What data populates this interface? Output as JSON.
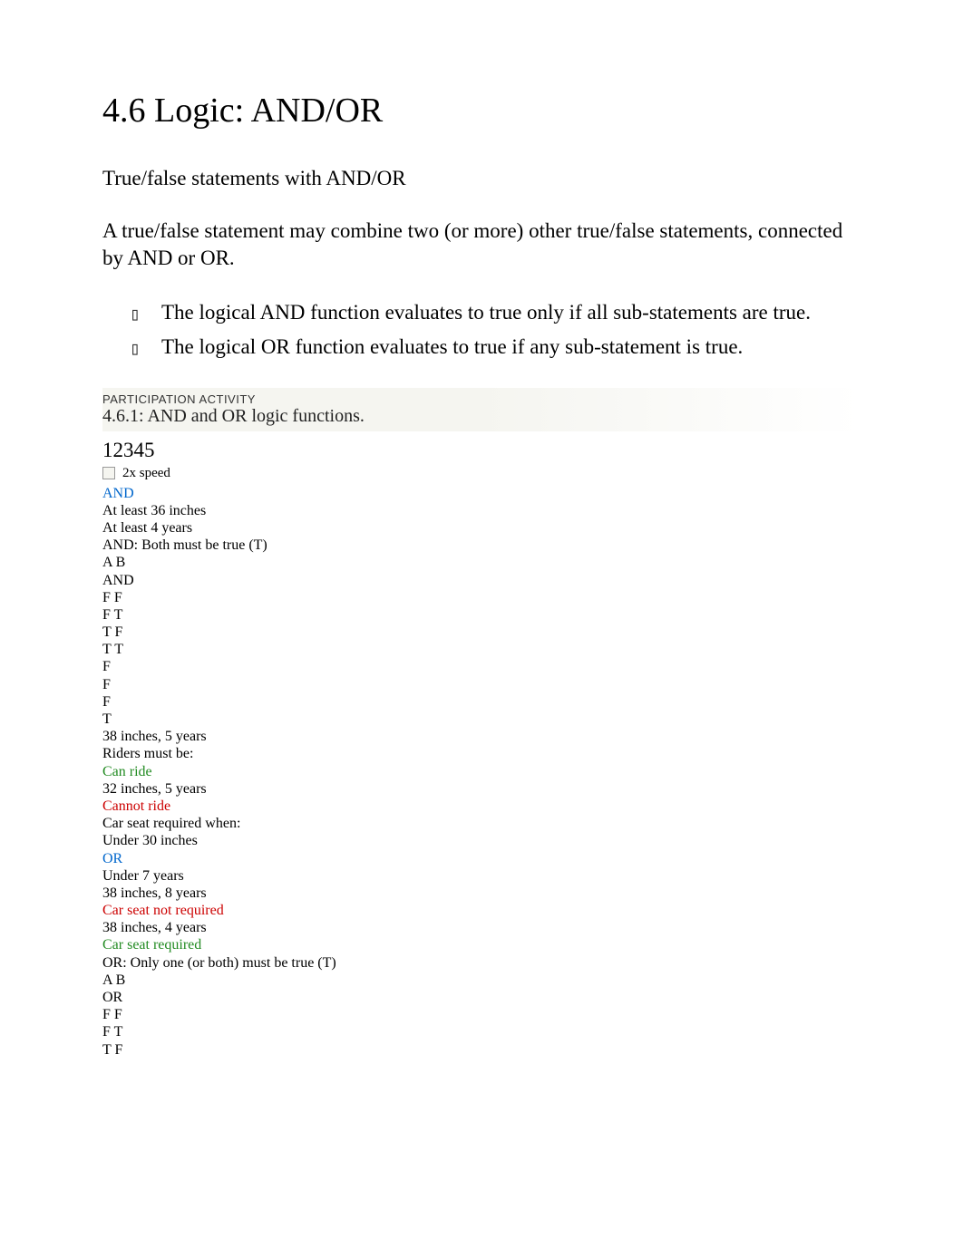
{
  "heading": "4.6 Logic: AND/OR",
  "subheading": "True/false statements with AND/OR",
  "intro": "A true/false statement may combine two (or more) other true/false statements, connected by AND or OR.",
  "bullets": [
    {
      "prefix": "The ",
      "term": "logical AND",
      "mid": "  function evaluates to true only if     all sub-statements are true."
    },
    {
      "prefix": "The ",
      "term": "logical OR",
      "mid": "  function evaluates to true if     any  sub-statement is true."
    }
  ],
  "activity": {
    "label": "PARTICIPATION ACTIVITY",
    "title": "4.6.1: AND and OR logic functions."
  },
  "nav": "12345",
  "speed": "2x speed",
  "lines": [
    {
      "text": "AND",
      "cls": "color-blue"
    },
    {
      "text": "At least 36 inches",
      "cls": ""
    },
    {
      "text": "At least 4 years",
      "cls": ""
    },
    {
      "text": "AND: Both must be true (T)",
      "cls": ""
    },
    {
      "text": "A B",
      "cls": ""
    },
    {
      "text": "AND",
      "cls": ""
    },
    {
      "text": "F F",
      "cls": ""
    },
    {
      "text": "F T",
      "cls": ""
    },
    {
      "text": "T F",
      "cls": ""
    },
    {
      "text": "T T",
      "cls": ""
    },
    {
      "text": "F",
      "cls": ""
    },
    {
      "text": "F",
      "cls": ""
    },
    {
      "text": "F",
      "cls": ""
    },
    {
      "text": "T",
      "cls": ""
    },
    {
      "text": "38 inches, 5 years",
      "cls": ""
    },
    {
      "text": "Riders must be:",
      "cls": ""
    },
    {
      "text": "Can ride",
      "cls": "color-green"
    },
    {
      "text": "32 inches, 5 years",
      "cls": ""
    },
    {
      "text": "Cannot ride",
      "cls": "color-red"
    },
    {
      "text": "Car seat required when:",
      "cls": ""
    },
    {
      "text": "Under 30 inches",
      "cls": ""
    },
    {
      "text": "OR",
      "cls": "color-blue"
    },
    {
      "text": "Under 7 years",
      "cls": ""
    },
    {
      "text": "38 inches, 8 years",
      "cls": ""
    },
    {
      "text": "Car seat not required",
      "cls": "color-red"
    },
    {
      "text": "38 inches, 4 years",
      "cls": ""
    },
    {
      "text": "Car seat required",
      "cls": "color-green"
    },
    {
      "text": "OR: Only one (or both) must be true (T)",
      "cls": ""
    },
    {
      "text": "A B",
      "cls": ""
    },
    {
      "text": "OR",
      "cls": ""
    },
    {
      "text": "F F",
      "cls": ""
    },
    {
      "text": "F T",
      "cls": ""
    },
    {
      "text": "T F",
      "cls": ""
    }
  ]
}
